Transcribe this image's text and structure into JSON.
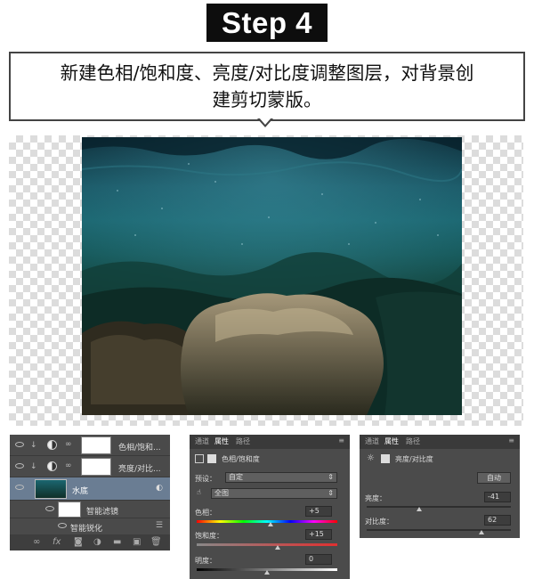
{
  "header": {
    "step_label": "Step 4"
  },
  "instruction": {
    "line1": "新建色相/饱和度、亮度/对比度调整图层，对背景创",
    "line2": "建剪切蒙版。"
  },
  "layers_panel": {
    "rows": [
      {
        "name": "色相/饱和...",
        "type": "adjustment",
        "clipped": true
      },
      {
        "name": "亮度/对比...",
        "type": "adjustment",
        "clipped": true
      },
      {
        "name": "水底",
        "type": "smart-object",
        "selected": true
      },
      {
        "name": "智能滤镜",
        "type": "smart-filter"
      },
      {
        "name": "智能锐化",
        "type": "filter"
      }
    ],
    "footer_icons": [
      "link-icon",
      "fx-icon",
      "mask-icon",
      "adjustment-icon",
      "folder-icon",
      "new-layer-icon",
      "trash-icon"
    ]
  },
  "hue_sat_panel": {
    "tabs": [
      "通道",
      "属性",
      "路径"
    ],
    "active_tab": "属性",
    "title": "色相/饱和度",
    "preset_label": "预设：",
    "preset_value": "自定",
    "channel_value": "全图",
    "hue_label": "色相：",
    "hue_value": "+5",
    "sat_label": "饱和度：",
    "sat_value": "+15",
    "light_label": "明度：",
    "light_value": "0"
  },
  "bc_panel": {
    "tabs": [
      "通道",
      "属性",
      "路径"
    ],
    "active_tab": "属性",
    "title": "亮度/对比度",
    "auto_button": "自动",
    "brightness_label": "亮度：",
    "brightness_value": "-41",
    "contrast_label": "对比度：",
    "contrast_value": "62"
  },
  "colors": {
    "panel_bg": "#4b4b4b",
    "selected_row": "#6a7d93",
    "accent": "#0d0d0d"
  }
}
